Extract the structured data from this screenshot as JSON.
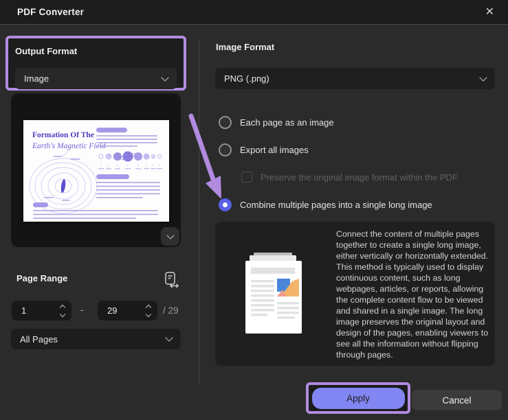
{
  "window": {
    "title": "PDF Converter",
    "close_icon": "✕"
  },
  "left_panel": {
    "output_format": {
      "label": "Output Format",
      "selected": "Image"
    },
    "preview": {
      "title_line1": "Formation Of The",
      "title_line2": "Earth's Magnetic Field"
    },
    "page_range": {
      "label": "Page Range",
      "from_value": "1",
      "separator": "-",
      "to_value": "29",
      "total": "/ 29",
      "scope_selected": "All Pages"
    }
  },
  "right_panel": {
    "image_format": {
      "label": "Image Format",
      "selected": "PNG (.png)"
    },
    "options": [
      {
        "label": "Each page as an image",
        "selected": false
      },
      {
        "label": "Export all images",
        "selected": false
      },
      {
        "label": "Combine multiple pages into a single long image",
        "selected": true
      }
    ],
    "preserve_checkbox": {
      "label": "Preserve the original image format within the PDF",
      "checked": false,
      "disabled": true
    },
    "description": "Connect the content of multiple pages together to create a single long image, either vertically or horizontally extended. This method is typically used to display continuous content, such as long webpages, articles, or reports, allowing the complete content flow to be viewed and shared in a single image. The long image preserves the original layout and design of the pages, enabling viewers to see all the information without flipping through pages."
  },
  "footer": {
    "apply": "Apply",
    "cancel": "Cancel"
  },
  "colors": {
    "accent_button": "#8286f2",
    "radio_selected": "#5a5fe6",
    "annotation_purple": "#b28be0"
  }
}
